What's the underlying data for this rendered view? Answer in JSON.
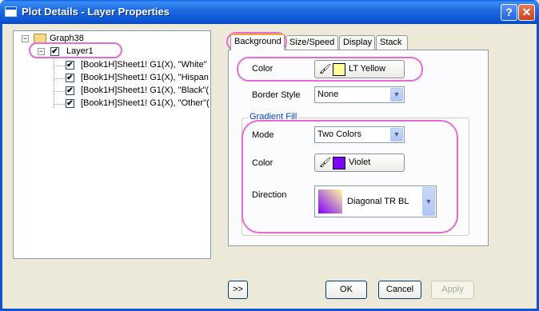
{
  "window": {
    "title": "Plot Details - Layer Properties",
    "help_glyph": "?",
    "close_glyph": "✕"
  },
  "tree": {
    "root": {
      "label": "Graph38",
      "expander": "−"
    },
    "layer": {
      "label": "Layer1",
      "expander": "−",
      "checked": "✔"
    },
    "items": [
      {
        "label": "[Book1H]Sheet1! G1(X), \"White\"",
        "checked": "✔"
      },
      {
        "label": "[Book1H]Sheet1! G1(X), \"Hispan",
        "checked": "✔"
      },
      {
        "label": "[Book1H]Sheet1! G1(X), \"Black\"(",
        "checked": "✔"
      },
      {
        "label": "[Book1H]Sheet1! G1(X), \"Other\"(",
        "checked": "✔"
      }
    ]
  },
  "tabs": [
    {
      "label": "Background"
    },
    {
      "label": "Size/Speed"
    },
    {
      "label": "Display"
    },
    {
      "label": "Stack"
    }
  ],
  "background": {
    "color_label": "Color",
    "color_value": "LT Yellow",
    "color_hex": "#ffff99",
    "border_style_label": "Border Style",
    "border_style_value": "None",
    "gradient": {
      "title": "Gradient Fill",
      "mode_label": "Mode",
      "mode_value": "Two Colors",
      "color_label": "Color",
      "color_value": "Violet",
      "color_hex": "#8000ff",
      "direction_label": "Direction",
      "direction_value": "Diagonal TR BL"
    }
  },
  "buttons": {
    "expand": ">>",
    "ok": "OK",
    "cancel": "Cancel",
    "apply": "Apply"
  },
  "bucket_glyph": "🖌",
  "arrow_glyph": "▼",
  "colors": {
    "title_bar": "#0b53d4",
    "highlight": "#e86ad8",
    "group_title": "#0046d5"
  }
}
